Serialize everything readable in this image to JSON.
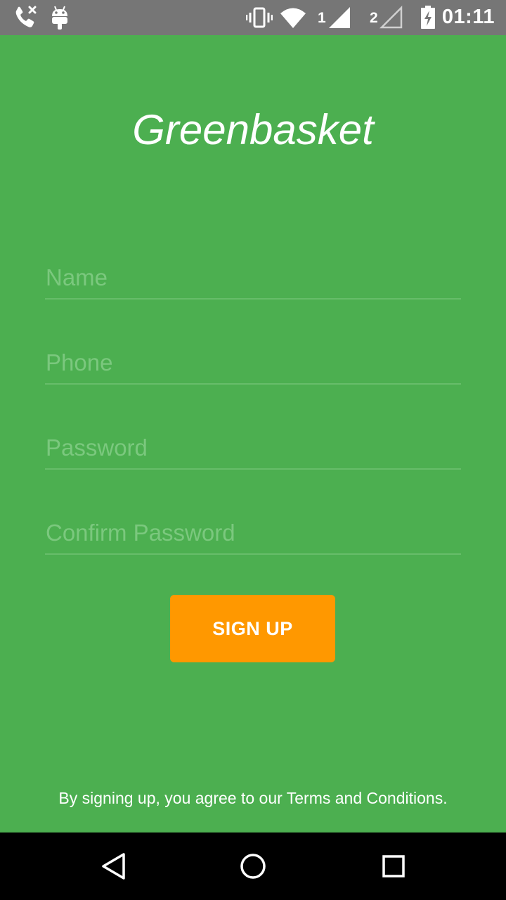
{
  "status_bar": {
    "time": "01:11",
    "sim1_label": "1",
    "sim2_label": "2",
    "icons": [
      "missed-call-icon",
      "android-icon",
      "vibrate-icon",
      "wifi-icon",
      "signal-sim1-icon",
      "signal-sim2-icon",
      "battery-charging-icon"
    ]
  },
  "app": {
    "title": "Greenbasket"
  },
  "form": {
    "name_placeholder": "Name",
    "phone_placeholder": "Phone",
    "password_placeholder": "Password",
    "confirm_password_placeholder": "Confirm Password",
    "signup_label": "SIGN UP",
    "terms_text": "By signing up, you agree to our Terms and Conditions."
  },
  "colors": {
    "background": "#4caf50",
    "button": "#ff9800",
    "status_bar": "#767676",
    "nav_bar": "#000000"
  },
  "nav_bar": {
    "icons": [
      "back-icon",
      "home-icon",
      "recents-icon"
    ]
  }
}
